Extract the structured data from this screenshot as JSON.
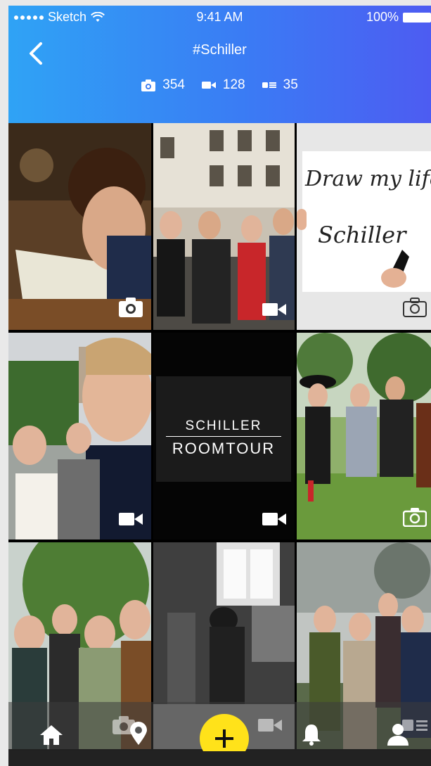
{
  "status_bar": {
    "carrier": "Sketch",
    "time": "9:41 AM",
    "battery": "100%"
  },
  "header": {
    "title": "#Schiller",
    "counts": {
      "photos": "354",
      "videos": "128",
      "stories": "35"
    }
  },
  "tiles": [
    {
      "kind": "photo",
      "icon": "camera-icon"
    },
    {
      "kind": "video",
      "icon": "video-icon"
    },
    {
      "kind": "photo",
      "icon": "camera-icon",
      "sign_line1": "Draw my life",
      "sign_line2": "Schiller"
    },
    {
      "kind": "video",
      "icon": "video-icon"
    },
    {
      "kind": "video",
      "icon": "video-icon",
      "card_top": "SCHILLER",
      "card_bottom": "ROOMTOUR"
    },
    {
      "kind": "photo",
      "icon": "camera-icon"
    },
    {
      "kind": "photo"
    },
    {
      "kind": "video"
    },
    {
      "kind": "photo"
    }
  ],
  "tabbar": {
    "items": [
      "home-icon",
      "location-pin-icon",
      "add-button",
      "notification-bell-icon",
      "profile-icon"
    ]
  },
  "colors": {
    "header_start": "#2fa3f5",
    "header_end": "#4d5cf2",
    "fab": "#ffe21a"
  }
}
